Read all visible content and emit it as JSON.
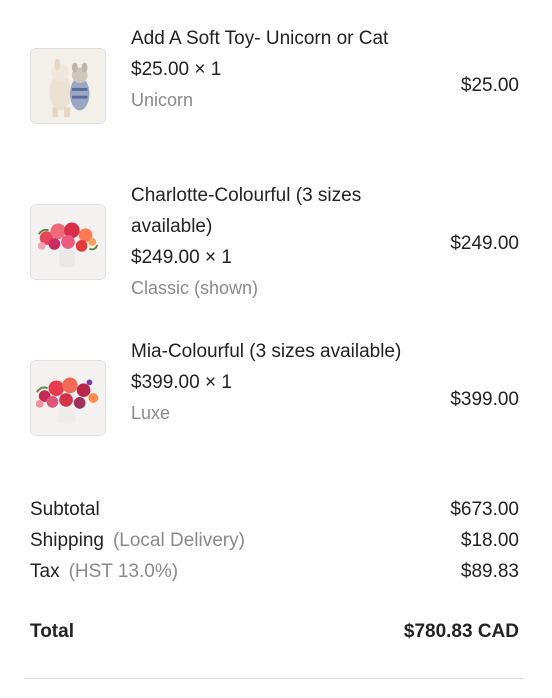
{
  "items": [
    {
      "name": "Add A Soft Toy- Unicorn or Cat",
      "unit_price": "$25.00 × 1",
      "variant": "Unicorn",
      "line_price": "$25.00",
      "image_icon": "plush-toys-image"
    },
    {
      "name": "Charlotte-Colourful (3 sizes available)",
      "unit_price": "$249.00 × 1",
      "variant": "Classic (shown)",
      "line_price": "$249.00",
      "image_icon": "flower-bouquet-image"
    },
    {
      "name": "Mia-Colourful (3 sizes available)",
      "unit_price": "$399.00 × 1",
      "variant": "Luxe",
      "line_price": "$399.00",
      "image_icon": "flower-arrangement-image"
    }
  ],
  "summary": {
    "subtotal_label": "Subtotal",
    "subtotal_value": "$673.00",
    "shipping_label": "Shipping",
    "shipping_note": "(Local Delivery)",
    "shipping_value": "$18.00",
    "tax_label": "Tax",
    "tax_note": "(HST 13.0%)",
    "tax_value": "$89.83",
    "total_label": "Total",
    "total_value": "$780.83 CAD"
  }
}
